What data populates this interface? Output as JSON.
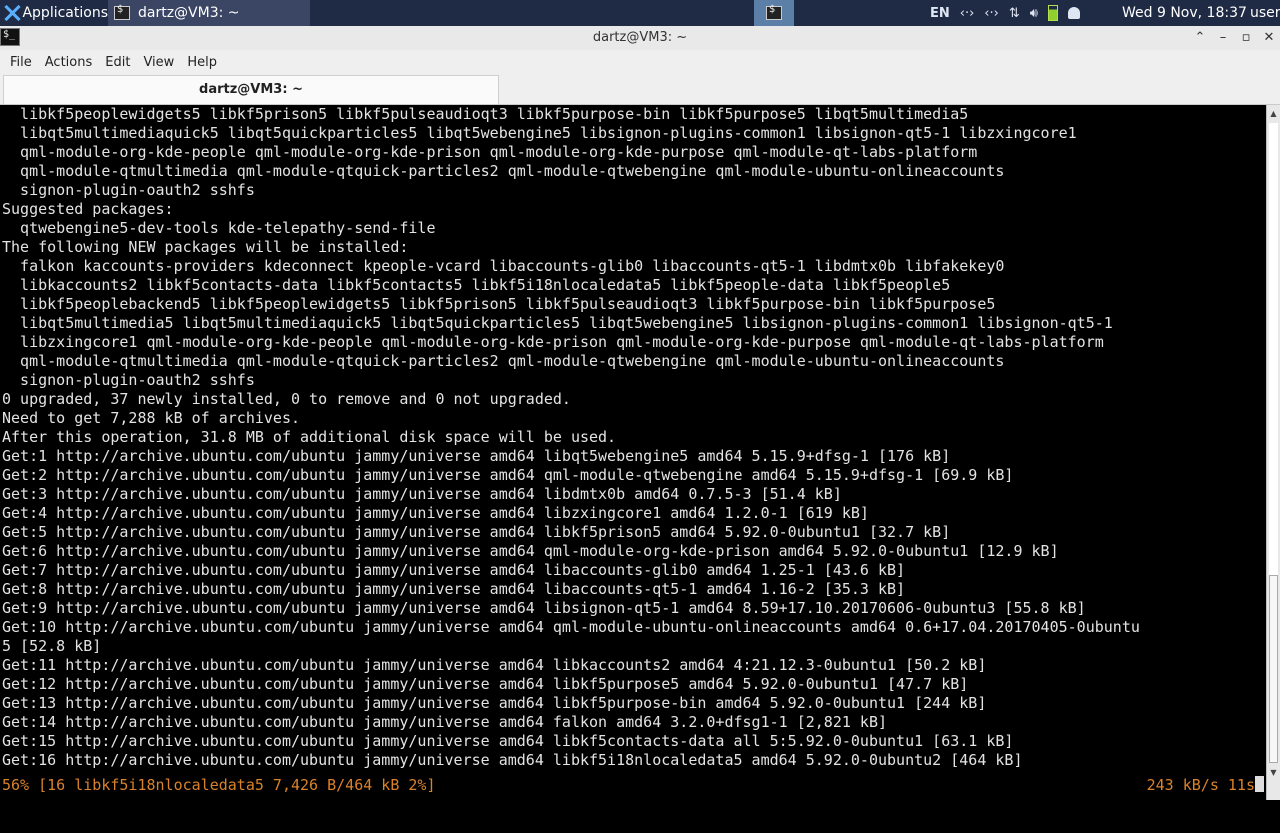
{
  "panel": {
    "applications_label": "Applications",
    "task_label": "dartz@VM3: ~",
    "language": "EN",
    "tray_icons": [
      "network-icon",
      "network-icon",
      "transfer-icon",
      "volume-icon",
      "battery-icon",
      "notification-bell-icon"
    ],
    "clock": "Wed  9 Nov, 18:37",
    "user": "user"
  },
  "window": {
    "title": "dartz@VM3: ~"
  },
  "menu": {
    "items": [
      "File",
      "Actions",
      "Edit",
      "View",
      "Help"
    ]
  },
  "tab": {
    "label": "dartz@VM3: ~"
  },
  "terminal": {
    "lines": [
      "  libkf5peoplewidgets5 libkf5prison5 libkf5pulseaudioqt3 libkf5purpose-bin libkf5purpose5 libqt5multimedia5",
      "  libqt5multimediaquick5 libqt5quickparticles5 libqt5webengine5 libsignon-plugins-common1 libsignon-qt5-1 libzxingcore1",
      "  qml-module-org-kde-people qml-module-org-kde-prison qml-module-org-kde-purpose qml-module-qt-labs-platform",
      "  qml-module-qtmultimedia qml-module-qtquick-particles2 qml-module-qtwebengine qml-module-ubuntu-onlineaccounts",
      "  signon-plugin-oauth2 sshfs",
      "Suggested packages:",
      "  qtwebengine5-dev-tools kde-telepathy-send-file",
      "The following NEW packages will be installed:",
      "  falkon kaccounts-providers kdeconnect kpeople-vcard libaccounts-glib0 libaccounts-qt5-1 libdmtx0b libfakekey0",
      "  libkaccounts2 libkf5contacts-data libkf5contacts5 libkf5i18nlocaledata5 libkf5people-data libkf5people5",
      "  libkf5peoplebackend5 libkf5peoplewidgets5 libkf5prison5 libkf5pulseaudioqt3 libkf5purpose-bin libkf5purpose5",
      "  libqt5multimedia5 libqt5multimediaquick5 libqt5quickparticles5 libqt5webengine5 libsignon-plugins-common1 libsignon-qt5-1",
      "  libzxingcore1 qml-module-org-kde-people qml-module-org-kde-prison qml-module-org-kde-purpose qml-module-qt-labs-platform",
      "  qml-module-qtmultimedia qml-module-qtquick-particles2 qml-module-qtwebengine qml-module-ubuntu-onlineaccounts",
      "  signon-plugin-oauth2 sshfs",
      "0 upgraded, 37 newly installed, 0 to remove and 0 not upgraded.",
      "Need to get 7,288 kB of archives.",
      "After this operation, 31.8 MB of additional disk space will be used.",
      "Get:1 http://archive.ubuntu.com/ubuntu jammy/universe amd64 libqt5webengine5 amd64 5.15.9+dfsg-1 [176 kB]",
      "Get:2 http://archive.ubuntu.com/ubuntu jammy/universe amd64 qml-module-qtwebengine amd64 5.15.9+dfsg-1 [69.9 kB]",
      "Get:3 http://archive.ubuntu.com/ubuntu jammy/universe amd64 libdmtx0b amd64 0.7.5-3 [51.4 kB]",
      "Get:4 http://archive.ubuntu.com/ubuntu jammy/universe amd64 libzxingcore1 amd64 1.2.0-1 [619 kB]",
      "Get:5 http://archive.ubuntu.com/ubuntu jammy/universe amd64 libkf5prison5 amd64 5.92.0-0ubuntu1 [32.7 kB]",
      "Get:6 http://archive.ubuntu.com/ubuntu jammy/universe amd64 qml-module-org-kde-prison amd64 5.92.0-0ubuntu1 [12.9 kB]",
      "Get:7 http://archive.ubuntu.com/ubuntu jammy/universe amd64 libaccounts-glib0 amd64 1.25-1 [43.6 kB]",
      "Get:8 http://archive.ubuntu.com/ubuntu jammy/universe amd64 libaccounts-qt5-1 amd64 1.16-2 [35.3 kB]",
      "Get:9 http://archive.ubuntu.com/ubuntu jammy/universe amd64 libsignon-qt5-1 amd64 8.59+17.10.20170606-0ubuntu3 [55.8 kB]",
      "Get:10 http://archive.ubuntu.com/ubuntu jammy/universe amd64 qml-module-ubuntu-onlineaccounts amd64 0.6+17.04.20170405-0ubuntu",
      "5 [52.8 kB]",
      "Get:11 http://archive.ubuntu.com/ubuntu jammy/universe amd64 libkaccounts2 amd64 4:21.12.3-0ubuntu1 [50.2 kB]",
      "Get:12 http://archive.ubuntu.com/ubuntu jammy/universe amd64 libkf5purpose5 amd64 5.92.0-0ubuntu1 [47.7 kB]",
      "Get:13 http://archive.ubuntu.com/ubuntu jammy/universe amd64 libkf5purpose-bin amd64 5.92.0-0ubuntu1 [244 kB]",
      "Get:14 http://archive.ubuntu.com/ubuntu jammy/universe amd64 falkon amd64 3.2.0+dfsg1-1 [2,821 kB]",
      "Get:15 http://archive.ubuntu.com/ubuntu jammy/universe amd64 libkf5contacts-data all 5:5.92.0-0ubuntu1 [63.1 kB]",
      "Get:16 http://archive.ubuntu.com/ubuntu jammy/universe amd64 libkf5i18nlocaledata5 amd64 5.92.0-0ubuntu2 [464 kB]"
    ],
    "progress_left": "56% [16 libkf5i18nlocaledata5 7,426 B/464 kB 2%]",
    "progress_right": "243 kB/s 11s",
    "progress_color": "#d9822b"
  }
}
